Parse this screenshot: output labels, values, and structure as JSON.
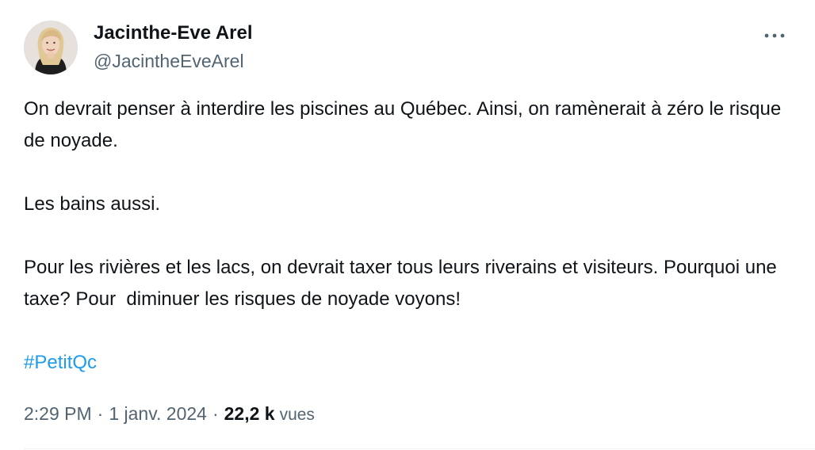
{
  "author": {
    "display_name": "Jacinthe-Eve Arel",
    "handle": "@JacintheEveArel",
    "avatar_icon": "profile-photo"
  },
  "menu": {
    "more_icon": "more-horizontal-icon"
  },
  "tweet": {
    "paragraphs": [
      "On devrait penser à interdire les piscines au Québec. Ainsi, on ramènerait à zéro le risque de noyade.",
      "Les bains aussi.",
      "Pour les rivières et les lacs, on devrait taxer tous leurs riverains et visiteurs. Pourquoi une taxe? Pour  diminuer les risques de noyade voyons!"
    ],
    "hashtag": "#PetitQc"
  },
  "meta": {
    "time": "2:29 PM",
    "separator": "·",
    "date": "1 janv. 2024",
    "views_count": "22,2 k",
    "views_label": "vues"
  },
  "colors": {
    "text": "#0f1419",
    "secondary": "#536471",
    "link": "#1d9bf0",
    "background": "#ffffff"
  }
}
